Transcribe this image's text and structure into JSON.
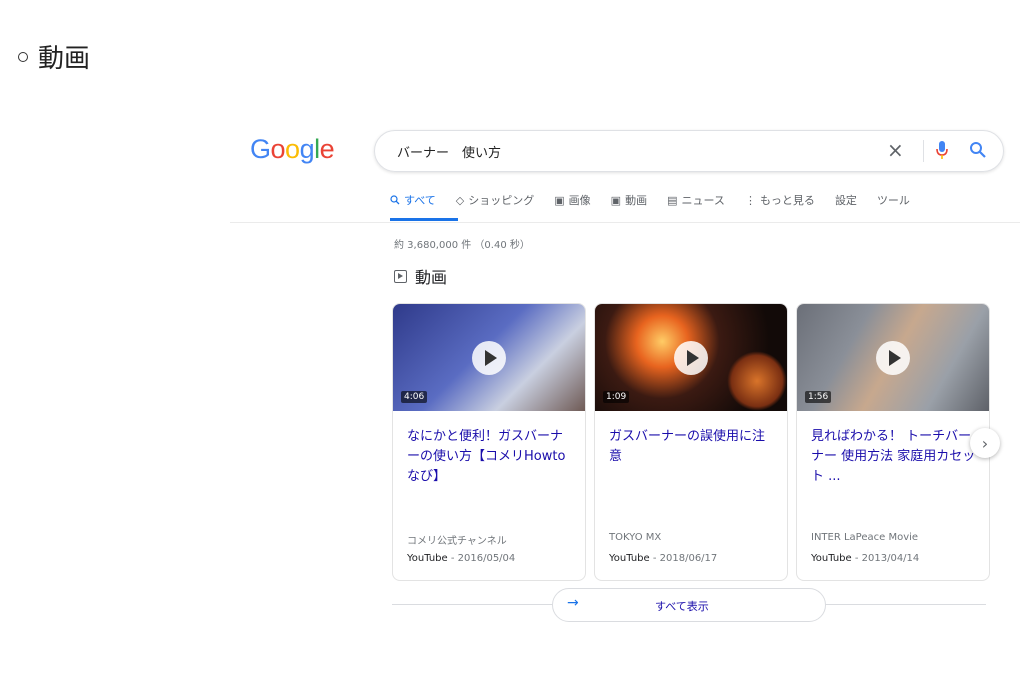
{
  "doc_heading": "動画",
  "search": {
    "query": "バーナー　使い方"
  },
  "tabs": [
    {
      "label": "すべて",
      "icon": "search-icon"
    },
    {
      "label": "ショッピング",
      "icon": "tag-icon"
    },
    {
      "label": "画像",
      "icon": "image-icon"
    },
    {
      "label": "動画",
      "icon": "video-icon"
    },
    {
      "label": "ニュース",
      "icon": "news-icon"
    },
    {
      "label": "もっと見る",
      "icon": "more-vert-icon"
    },
    {
      "label": "設定"
    },
    {
      "label": "ツール"
    }
  ],
  "results": {
    "stats": "約 3,680,000 件 （0.40 秒）",
    "section_title": "動画"
  },
  "videos": [
    {
      "duration": "4:06",
      "title": "なにかと便利！ガスバーナーの使い方【コメリHowtoなび】",
      "channel": "コメリ公式チャンネル",
      "platform": "YouTube",
      "date": " - 2016/05/04"
    },
    {
      "duration": "1:09",
      "title": "ガスバーナーの誤使用に注意",
      "channel": "TOKYO MX",
      "platform": "YouTube",
      "date": " - 2018/06/17"
    },
    {
      "duration": "1:56",
      "title": "見ればわかる！ トーチバーナー 使用方法 家庭用カセット ...",
      "channel": "INTER LaPeace Movie",
      "platform": "YouTube",
      "date": " - 2013/04/14"
    }
  ],
  "show_all": {
    "label": "すべて表示"
  },
  "colors": {
    "link": "#1a0dab",
    "accent": "#1a73e8"
  }
}
